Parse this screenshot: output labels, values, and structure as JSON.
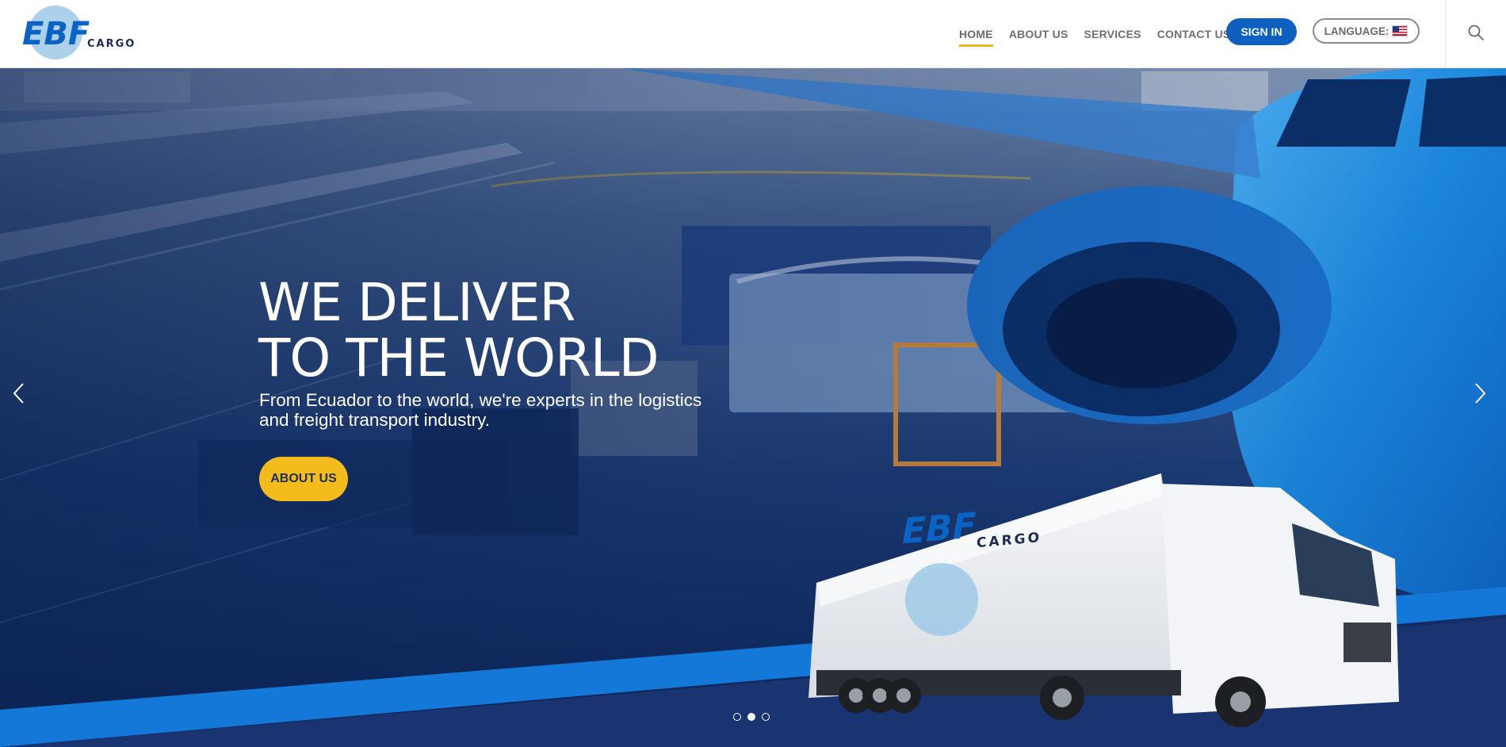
{
  "brand": {
    "logo_text": "EBF",
    "logo_subtext": "CARGO"
  },
  "nav": {
    "items": [
      {
        "label": "HOME",
        "active": true
      },
      {
        "label": "ABOUT US",
        "active": false
      },
      {
        "label": "SERVICES",
        "active": false
      },
      {
        "label": "CONTACT US",
        "active": false
      }
    ],
    "sign_in_label": "SIGN IN",
    "language_label": "LANGUAGE:",
    "language_flag_icon": "us-flag-icon",
    "search_icon": "search-icon"
  },
  "hero": {
    "title_lines": [
      "WE DELIVER",
      "TO THE WORLD"
    ],
    "subtitle_lines": [
      "From Ecuador to the world, we're experts in the logistics",
      "and freight transport industry."
    ],
    "cta_label": "ABOUT US",
    "truck_brand_text": "EBF",
    "truck_brand_subtext": "CARGO",
    "slide_count": 3,
    "active_slide": 2
  },
  "colors": {
    "primary_blue": "#0d60c0",
    "accent_yellow": "#f4bb1c",
    "nav_text": "#6f6f6f",
    "hero_dark": "#0c2a63"
  }
}
